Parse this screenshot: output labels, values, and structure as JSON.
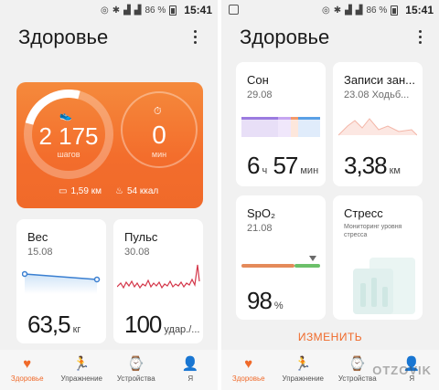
{
  "status": {
    "battery": "86 %",
    "time": "15:41"
  },
  "left": {
    "title": "Здоровье",
    "activity": {
      "steps_value": "2 175",
      "steps_label": "шагов",
      "minutes_value": "0",
      "minutes_label": "мин",
      "distance": "1,59 км",
      "calories": "54 ккал",
      "steps_progress": 0.22
    },
    "weight": {
      "title": "Вес",
      "date": "15.08",
      "value": "63,5",
      "unit": "кг"
    },
    "pulse": {
      "title": "Пульс",
      "date": "30.08",
      "value": "100",
      "unit": "удар./..."
    }
  },
  "right": {
    "title": "Здоровье",
    "sleep": {
      "title": "Сон",
      "date": "29.08",
      "hours": "6",
      "hours_unit": "ч",
      "minutes": "57",
      "minutes_unit": "мин"
    },
    "records": {
      "title": "Записи зан...",
      "date": "23.08 Ходьб...",
      "value": "3,38",
      "unit": "км"
    },
    "spo2": {
      "title": "SpO₂",
      "date": "21.08",
      "value": "98",
      "unit": "%"
    },
    "stress": {
      "title": "Стресс",
      "subtitle": "Мониторинг уровня стресса"
    },
    "change_label": "ИЗМЕНИТЬ"
  },
  "nav": {
    "items": [
      {
        "label": "Здоровье",
        "icon": "heart-icon"
      },
      {
        "label": "Упражнение",
        "icon": "runner-icon"
      },
      {
        "label": "Устройства",
        "icon": "watch-icon"
      },
      {
        "label": "Я",
        "icon": "person-icon"
      }
    ]
  },
  "watermark": "OTZOVIK",
  "colors": {
    "accent": "#f06a2a",
    "background": "#f1f1f1",
    "card": "#ffffff"
  }
}
